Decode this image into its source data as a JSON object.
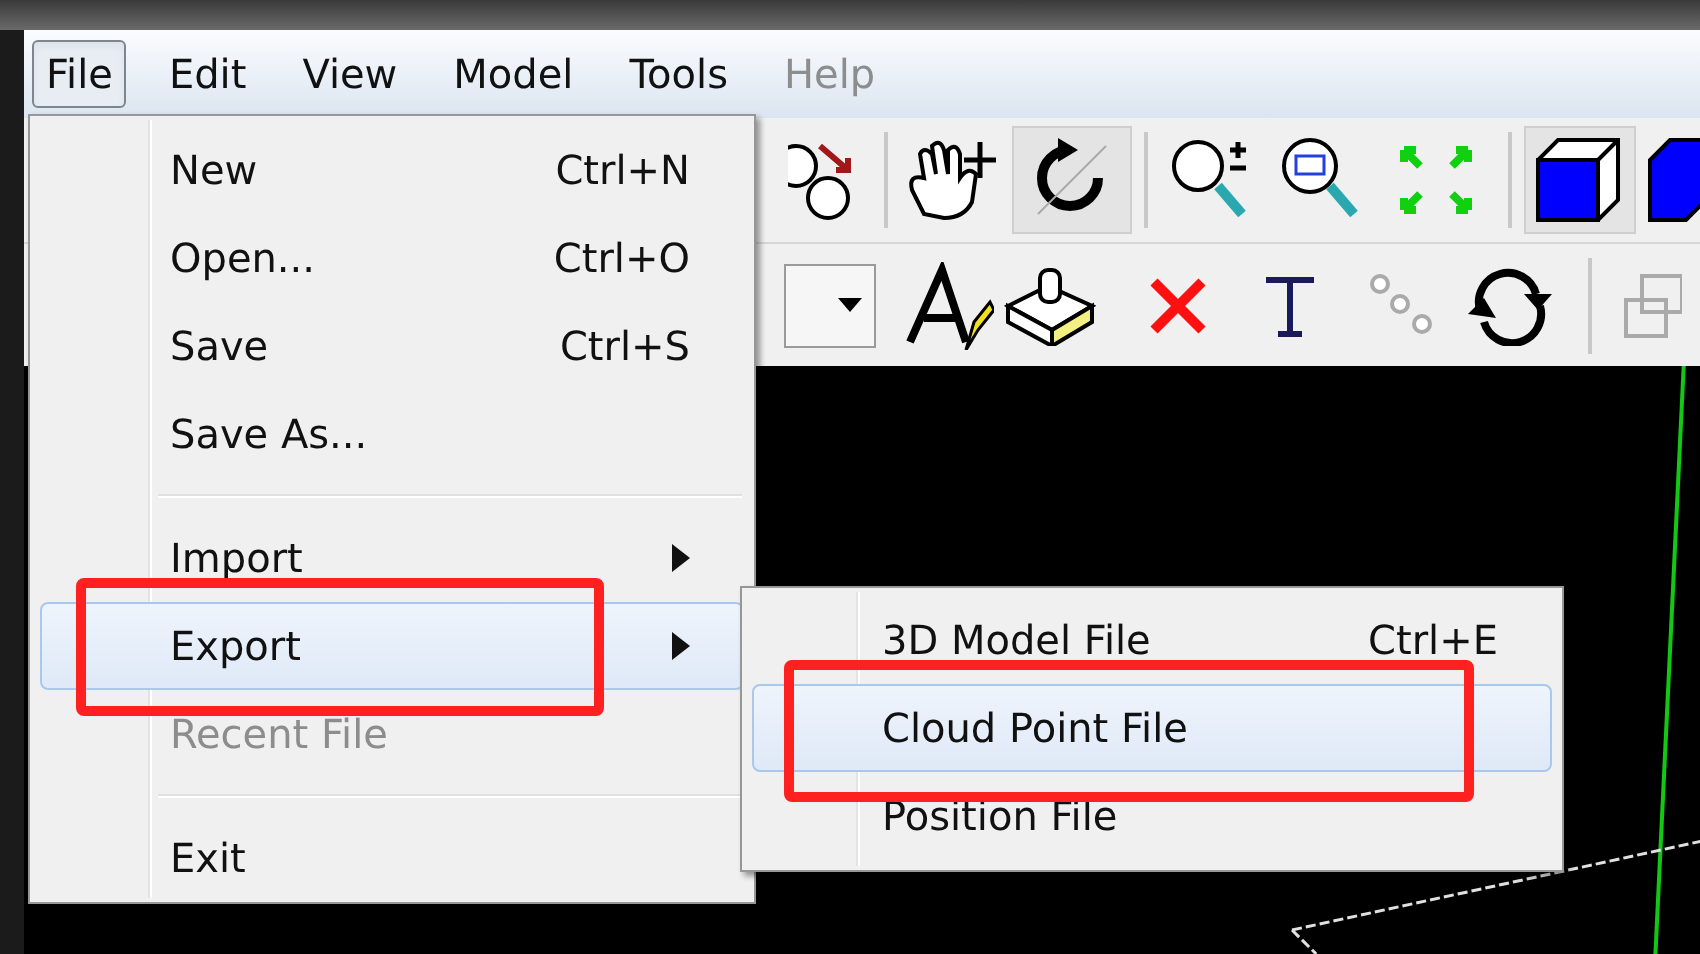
{
  "menubar": [
    {
      "label": "File",
      "selected": true,
      "disabled": false
    },
    {
      "label": "Edit",
      "selected": false,
      "disabled": false
    },
    {
      "label": "View",
      "selected": false,
      "disabled": false
    },
    {
      "label": "Model",
      "selected": false,
      "disabled": false
    },
    {
      "label": "Tools",
      "selected": false,
      "disabled": false
    },
    {
      "label": "Help",
      "selected": false,
      "disabled": true
    }
  ],
  "file_menu": [
    {
      "kind": "item",
      "label": "New",
      "shortcut": "Ctrl+N",
      "submenu": false,
      "selected": false,
      "disabled": false
    },
    {
      "kind": "item",
      "label": "Open...",
      "shortcut": "Ctrl+O",
      "submenu": false,
      "selected": false,
      "disabled": false
    },
    {
      "kind": "item",
      "label": "Save",
      "shortcut": "Ctrl+S",
      "submenu": false,
      "selected": false,
      "disabled": false
    },
    {
      "kind": "item",
      "label": "Save As...",
      "submenu": false,
      "selected": false,
      "disabled": false
    },
    {
      "kind": "separator"
    },
    {
      "kind": "item",
      "label": "Import",
      "submenu": true,
      "selected": false,
      "disabled": false
    },
    {
      "kind": "item",
      "label": "Export",
      "submenu": true,
      "selected": true,
      "disabled": false
    },
    {
      "kind": "item",
      "label": "Recent File",
      "submenu": false,
      "selected": false,
      "disabled": true
    },
    {
      "kind": "separator"
    },
    {
      "kind": "item",
      "label": "Exit",
      "submenu": false,
      "selected": false,
      "disabled": false
    }
  ],
  "export_submenu": [
    {
      "label": "3D Model File",
      "shortcut": "Ctrl+E",
      "selected": false
    },
    {
      "label": "Cloud Point File",
      "selected": true
    },
    {
      "label": "Position File",
      "selected": false
    }
  ]
}
